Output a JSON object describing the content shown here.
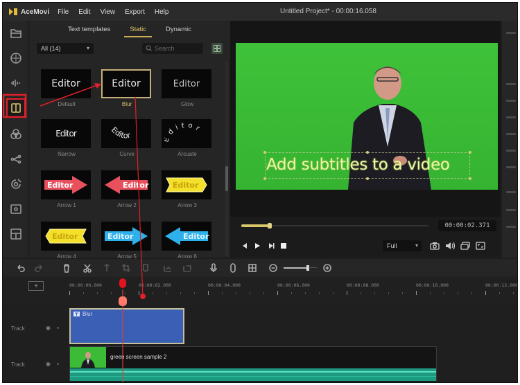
{
  "app": {
    "name": "AceMovi",
    "menu": [
      "File",
      "Edit",
      "View",
      "Export",
      "Help"
    ],
    "title": "Untitled Project* - 00:00:16.058"
  },
  "sidebar": {
    "items": [
      {
        "name": "media",
        "icon": "folder-icon"
      },
      {
        "name": "effects",
        "icon": "layers-icon"
      },
      {
        "name": "audio",
        "icon": "audio-icon"
      },
      {
        "name": "text",
        "icon": "text-icon",
        "active": true
      },
      {
        "name": "filters",
        "icon": "filter-circles-icon"
      },
      {
        "name": "transitions",
        "icon": "transition-icon"
      },
      {
        "name": "elements",
        "icon": "sticker-icon"
      },
      {
        "name": "record",
        "icon": "record-icon"
      },
      {
        "name": "templates",
        "icon": "layout-icon"
      }
    ]
  },
  "panel": {
    "tabs": [
      {
        "label": "Text templates",
        "active": false
      },
      {
        "label": "Static",
        "active": true
      },
      {
        "label": "Dynamic",
        "active": false
      }
    ],
    "filter": {
      "value": "All (14)"
    },
    "search": {
      "placeholder": "Search"
    },
    "templates": [
      {
        "label": "Default",
        "preview": "Editor",
        "style": "plain"
      },
      {
        "label": "Blur",
        "preview": "Editor",
        "style": "plain",
        "selected": true
      },
      {
        "label": "Glow",
        "preview": "Editor",
        "style": "glow"
      },
      {
        "label": "Narrow",
        "preview": "Editor",
        "style": "narrow"
      },
      {
        "label": "Curve",
        "preview": "Editor",
        "style": "curve"
      },
      {
        "label": "Arcuate",
        "preview": "Editor",
        "style": "arcuate"
      },
      {
        "label": "Arrow 1",
        "preview": "Editor",
        "style": "arrow",
        "color": "#e8505e",
        "direction": "right"
      },
      {
        "label": "Arrow 2",
        "preview": "Editor",
        "style": "arrow",
        "color": "#e8505e",
        "direction": "left"
      },
      {
        "label": "Arrow 3",
        "preview": "Editor",
        "style": "chevron",
        "color": "#f4df2a",
        "direction": "right"
      },
      {
        "label": "Arrow 4",
        "preview": "Editor",
        "style": "chevron",
        "color": "#f4df2a",
        "direction": "left"
      },
      {
        "label": "Arrow 5",
        "preview": "Editor",
        "style": "arrow",
        "color": "#2eb0ea",
        "direction": "right"
      },
      {
        "label": "Arrow 6",
        "preview": "Editor",
        "style": "arrow",
        "color": "#2eb0ea",
        "direction": "left"
      }
    ]
  },
  "preview": {
    "subtitle": "Add subtitles to a video",
    "timecode": "00:00:02.371",
    "progress_fraction": 0.15,
    "zoom_option": "Full",
    "controls": [
      "prev-frame",
      "play",
      "next-frame",
      "stop"
    ],
    "actions": [
      "snapshot-icon",
      "volume-icon",
      "chat-icon",
      "fullscreen-icon"
    ]
  },
  "toolbar": {
    "tools": [
      "undo",
      "redo",
      "delete",
      "cut",
      "split",
      "crop",
      "marker",
      "speed",
      "freeze",
      "mic",
      "record",
      "grid",
      "zoom-out",
      "zoom-in"
    ],
    "zoom_level_fraction": 0.75
  },
  "ruler": {
    "labels": [
      "00:00:00.000",
      "00:00:02.000",
      "00:00:04.000",
      "00:00:06.000",
      "00:00:08.000",
      "00:00:10.000",
      "00:00:12.000"
    ]
  },
  "tracks": [
    {
      "name": "Track",
      "clip": {
        "label": "Blur",
        "type": "text"
      }
    },
    {
      "name": "Track",
      "clip": {
        "label": "green screen sample 2",
        "type": "video"
      }
    }
  ],
  "colors": {
    "accent": "#d7c56a",
    "highlight": "#e0202a",
    "text_clip": "#3a5fb4",
    "audio": "#1e9a80",
    "green_screen": "#3fc23a"
  }
}
